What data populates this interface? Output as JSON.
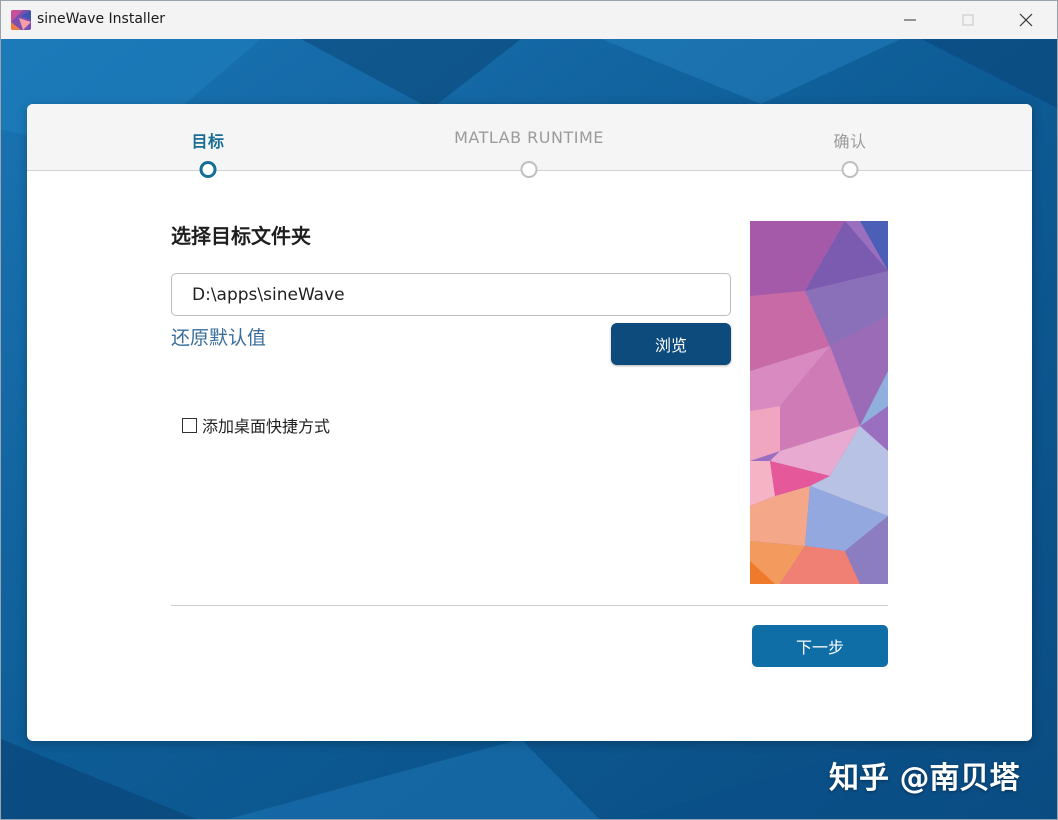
{
  "window": {
    "title": "sineWave Installer",
    "minimize_icon": "minimize-icon",
    "maximize_icon": "maximize-icon",
    "close_icon": "close-icon"
  },
  "steps": [
    {
      "label": "目标",
      "active": true
    },
    {
      "label": "MATLAB RUNTIME",
      "active": false
    },
    {
      "label": "确认",
      "active": false
    }
  ],
  "content": {
    "section_title": "选择目标文件夹",
    "path_value": "D:\\apps\\sineWave",
    "restore_default_label": "还原默认值",
    "browse_label": "浏览",
    "shortcut_label": "添加桌面快捷方式",
    "shortcut_checked": false,
    "next_label": "下一步"
  },
  "watermark": "知乎 @南贝塔",
  "colors": {
    "background_blue": "#0f5f99",
    "active_step": "#1a6e96",
    "browse_button": "#0d4b7d",
    "next_button": "#0f6ea6",
    "link": "#3a6e9a"
  }
}
